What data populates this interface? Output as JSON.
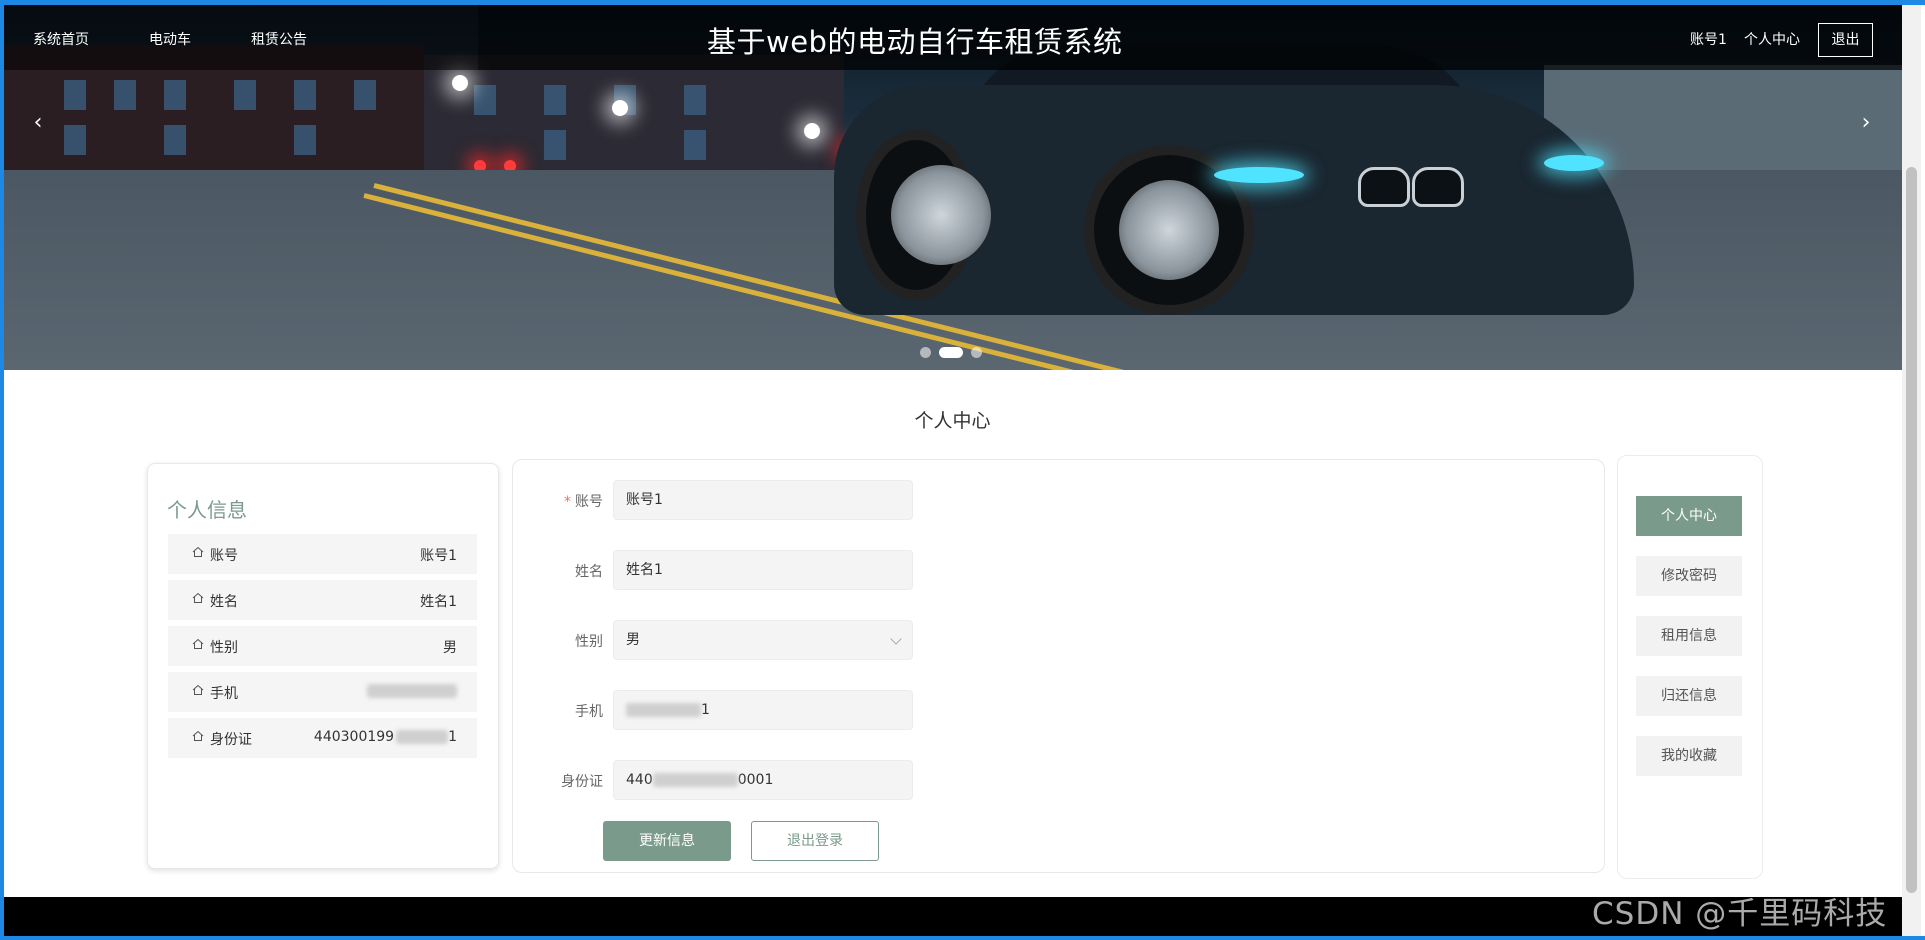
{
  "nav": {
    "items": [
      {
        "label": "系统首页"
      },
      {
        "label": "电动车"
      },
      {
        "label": "租赁公告"
      }
    ],
    "site_title": "基于web的电动自行车租赁系统",
    "account": "账号1",
    "personal_center": "个人中心",
    "logout": "退出"
  },
  "carousel": {
    "slides": 3,
    "active_index": 1
  },
  "page_title": "个人中心",
  "info_card": {
    "title": "个人信息",
    "rows": [
      {
        "label": "账号",
        "value": "账号1"
      },
      {
        "label": "姓名",
        "value": "姓名1"
      },
      {
        "label": "性别",
        "value": "男"
      },
      {
        "label": "手机",
        "value": ""
      },
      {
        "label": "身份证",
        "value": "440300199"
      }
    ]
  },
  "form": {
    "fields": {
      "account": {
        "label": "账号",
        "value": "账号1",
        "required": true
      },
      "name": {
        "label": "姓名",
        "value": "姓名1"
      },
      "gender": {
        "label": "性别",
        "value": "男"
      },
      "phone": {
        "label": "手机",
        "value_prefix": "",
        "value_suffix": "1"
      },
      "idcard": {
        "label": "身份证",
        "value_prefix": "440",
        "value_suffix": "0001"
      }
    },
    "update_button": "更新信息",
    "logout_button": "退出登录"
  },
  "side_menu": {
    "items": [
      {
        "label": "个人中心",
        "active": true
      },
      {
        "label": "修改密码"
      },
      {
        "label": "租用信息"
      },
      {
        "label": "归还信息"
      },
      {
        "label": "我的收藏"
      }
    ]
  },
  "watermark": "CSDN @千里码科技",
  "colors": {
    "accent": "#7a9a8b",
    "title_accent": "#7b9a8c",
    "required": "#f56c6c"
  }
}
